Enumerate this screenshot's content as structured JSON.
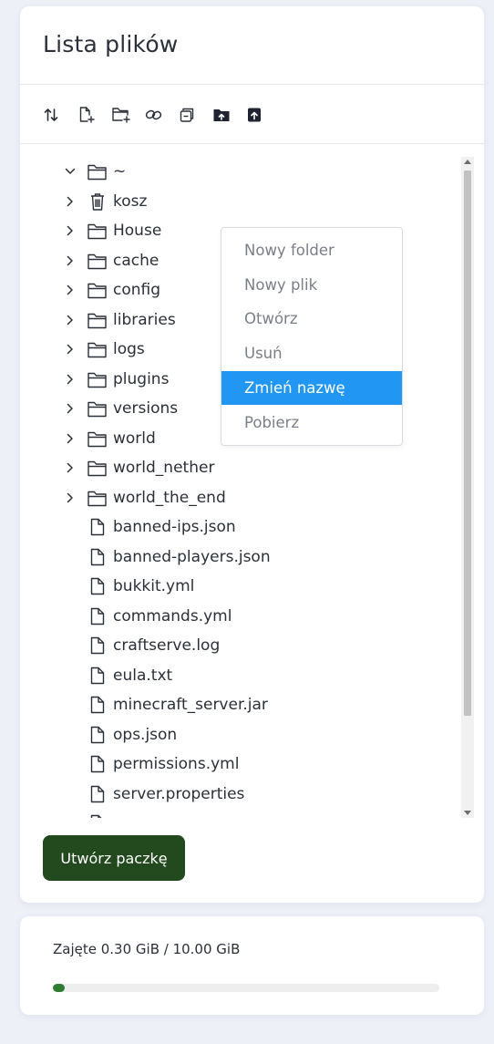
{
  "file_panel": {
    "title": "Lista plików",
    "toolbar": [
      {
        "name": "sort-button",
        "icon": "sort-icon"
      },
      {
        "name": "new-file-button",
        "icon": "file-plus-icon"
      },
      {
        "name": "new-folder-button",
        "icon": "folder-plus-icon"
      },
      {
        "name": "link-button",
        "icon": "link-icon"
      },
      {
        "name": "collapse-all-button",
        "icon": "collapse-icon"
      },
      {
        "name": "upload-folder-button",
        "icon": "folder-upload-icon"
      },
      {
        "name": "upload-file-button",
        "icon": "file-upload-icon"
      }
    ],
    "tree": [
      {
        "label": "~",
        "type": "folder",
        "expanded": true,
        "chevron": "down"
      },
      {
        "label": "kosz",
        "type": "trash",
        "chevron": "right"
      },
      {
        "label": "House",
        "type": "folder",
        "chevron": "right"
      },
      {
        "label": "cache",
        "type": "folder",
        "chevron": "right"
      },
      {
        "label": "config",
        "type": "folder",
        "chevron": "right"
      },
      {
        "label": "libraries",
        "type": "folder",
        "chevron": "right"
      },
      {
        "label": "logs",
        "type": "folder",
        "chevron": "right"
      },
      {
        "label": "plugins",
        "type": "folder",
        "chevron": "right"
      },
      {
        "label": "versions",
        "type": "folder",
        "chevron": "right"
      },
      {
        "label": "world",
        "type": "folder",
        "chevron": "right"
      },
      {
        "label": "world_nether",
        "type": "folder",
        "chevron": "right"
      },
      {
        "label": "world_the_end",
        "type": "folder",
        "chevron": "right"
      },
      {
        "label": "banned-ips.json",
        "type": "file"
      },
      {
        "label": "banned-players.json",
        "type": "file"
      },
      {
        "label": "bukkit.yml",
        "type": "file"
      },
      {
        "label": "commands.yml",
        "type": "file"
      },
      {
        "label": "craftserve.log",
        "type": "file"
      },
      {
        "label": "eula.txt",
        "type": "file"
      },
      {
        "label": "minecraft_server.jar",
        "type": "file"
      },
      {
        "label": "ops.json",
        "type": "file"
      },
      {
        "label": "permissions.yml",
        "type": "file"
      },
      {
        "label": "server.properties",
        "type": "file"
      },
      {
        "label": "",
        "type": "file"
      }
    ],
    "context_menu": {
      "items": [
        {
          "label": "Nowy folder",
          "active": false
        },
        {
          "label": "Nowy plik",
          "active": false
        },
        {
          "label": "Otwórz",
          "active": false
        },
        {
          "label": "Usuń",
          "active": false
        },
        {
          "label": "Zmień nazwę",
          "active": true
        },
        {
          "label": "Pobierz",
          "active": false
        }
      ]
    },
    "create_package_label": "Utwórz paczkę"
  },
  "usage": {
    "text": "Zajęte 0.30 GiB / 10.00 GiB",
    "fraction": 0.03
  },
  "colors": {
    "background": "#eef0f8",
    "primary_button": "#234a1f",
    "menu_highlight": "#2196f3",
    "progress_fill": "#2e7d32",
    "text": "#2b3038"
  }
}
